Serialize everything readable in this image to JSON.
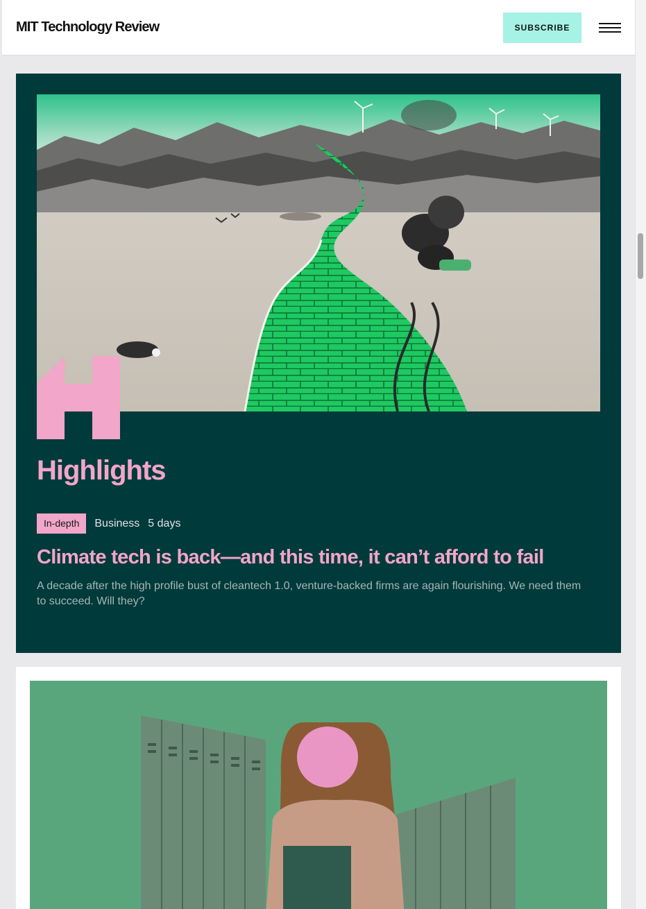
{
  "header": {
    "logo": "MIT Technology Review",
    "subscribe_label": "SUBSCRIBE",
    "menu_icon": "hamburger-menu-icon"
  },
  "highlights": {
    "section_title": "Highlights",
    "badge_icon": "highlights-h-logo-icon",
    "article": {
      "tag": "In-depth",
      "category": "Business",
      "age": "5 days",
      "title": "Climate tech is back—and this time, it can’t afford to fail",
      "dek": "A decade after the high profile bust of cleantech 1.0, venture-backed firms are again flourishing. We need them to succeed. Will they?"
    }
  },
  "colors": {
    "brand_mint": "#a6f2e4",
    "card_dark_teal": "#003a3b",
    "accent_pink": "#f2a6c9",
    "page_bg": "#e9e9ec"
  }
}
